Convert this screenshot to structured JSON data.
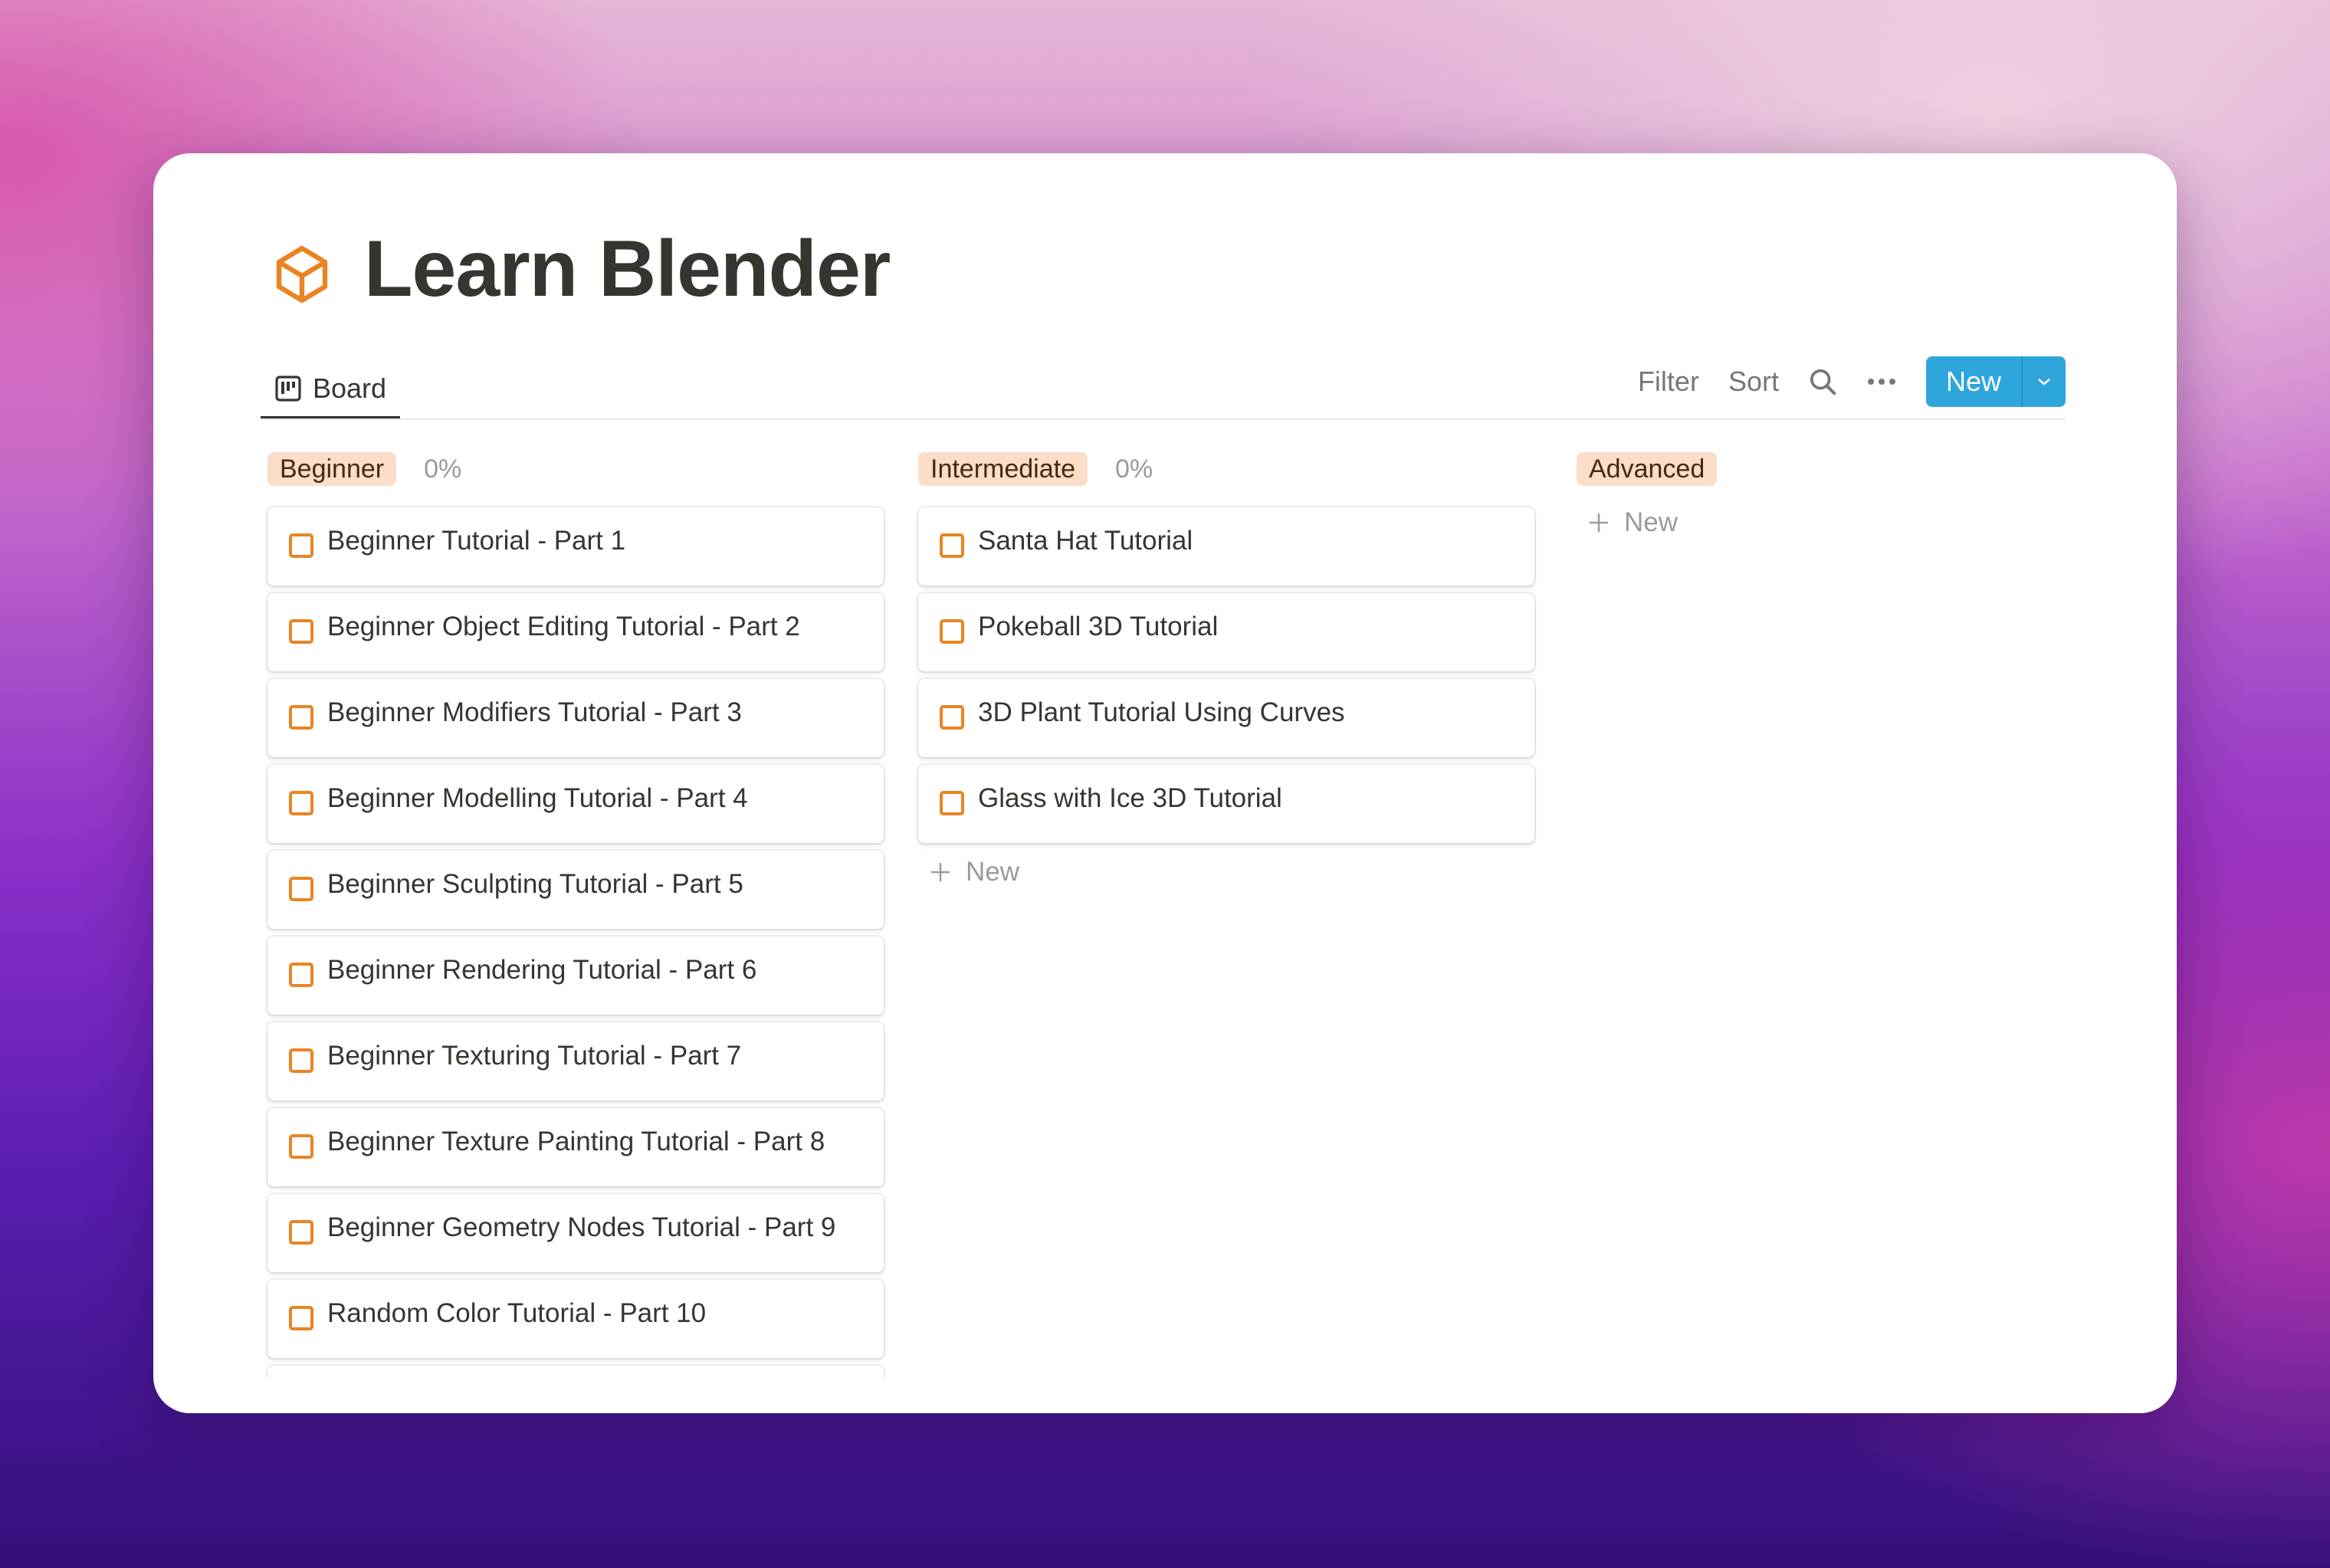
{
  "page": {
    "title": "Learn Blender",
    "icon": "cube-icon"
  },
  "tabs": [
    {
      "label": "Board",
      "icon": "board-icon",
      "active": true
    }
  ],
  "toolbar": {
    "filter": "Filter",
    "sort": "Sort",
    "new": "New"
  },
  "colors": {
    "accent": "#2ea6dc",
    "tag_bg": "#fadec9",
    "checkbox": "#ea8422"
  },
  "columns": [
    {
      "label": "Beginner",
      "progress": "0%",
      "cards": [
        "Beginner Tutorial - Part 1",
        "Beginner Object Editing Tutorial - Part 2",
        "Beginner Modifiers Tutorial - Part 3",
        "Beginner Modelling Tutorial - Part 4",
        "Beginner Sculpting Tutorial - Part 5",
        "Beginner Rendering Tutorial - Part 6",
        "Beginner Texturing Tutorial - Part 7",
        "Beginner Texture Painting Tutorial - Part 8",
        "Beginner Geometry Nodes Tutorial - Part 9",
        "Random Color Tutorial - Part 10"
      ]
    },
    {
      "label": "Intermediate",
      "progress": "0%",
      "cards": [
        "Santa Hat Tutorial",
        "Pokeball 3D Tutorial",
        "3D Plant Tutorial Using Curves",
        "Glass with Ice 3D Tutorial"
      ],
      "add_label": "New"
    },
    {
      "label": "Advanced",
      "cards": [],
      "add_label": "New"
    }
  ]
}
